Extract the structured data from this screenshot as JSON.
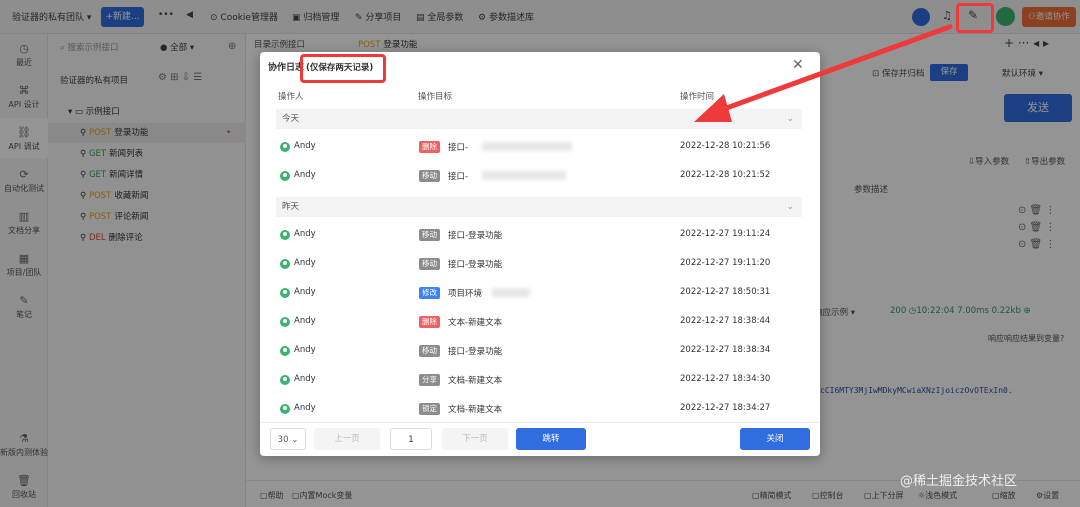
{
  "topbar": {
    "team": "验证器的私有团队",
    "new_btn": "+新建...",
    "more": "•••",
    "tabs": [
      "Cookie管理器",
      "归档管理",
      "分享项目",
      "全局参数",
      "参数描述库"
    ],
    "invite": "邀请协作"
  },
  "sidebar": {
    "items": [
      "最近",
      "API 设计",
      "API 调试",
      "自动化测试",
      "文档分享",
      "项目/团队",
      "笔记",
      "新版内测体验",
      "回收站"
    ]
  },
  "tree": {
    "search_placeholder": "搜索示例接口",
    "filter": "全部",
    "project": "验证器的私有项目",
    "folder": "示例接口",
    "items": [
      {
        "method": "POST",
        "name": "登录功能"
      },
      {
        "method": "GET",
        "name": "新闻列表"
      },
      {
        "method": "GET",
        "name": "新闻详情"
      },
      {
        "method": "POST",
        "name": "收藏新闻"
      },
      {
        "method": "POST",
        "name": "评论新闻"
      },
      {
        "method": "DEL",
        "name": "删除评论"
      }
    ]
  },
  "main": {
    "tab_folder": "目录示例接口",
    "tab_active_method": "POST",
    "tab_active_name": "登录功能",
    "save_btn": "保存",
    "save_and_clear": "保存并归档",
    "env": "默认环境",
    "send": "发送",
    "import": "导入参数",
    "export": "导出参数",
    "param_desc": "参数描述",
    "resp_example": "响应示例",
    "status": "200",
    "time": "10:22:04",
    "duration": "7.00ms",
    "size": "0.22kb",
    "resp_hint": "响应响应结果到变量?",
    "token_text": "cCI6MTY3MjIwMDkyMCwiaXNzIjoiczOvOTExIn0.",
    "bottom": [
      "帮助",
      "内置Mock变量",
      "精简模式",
      "控制台",
      "上下分屏",
      "浅色模式",
      "缩放",
      "设置"
    ]
  },
  "modal": {
    "title": "协作日志",
    "subtitle": "(仅保存两天记录)",
    "col_user": "操作人",
    "col_target": "操作目标",
    "col_time": "操作时间",
    "groups": [
      {
        "label": "今天",
        "rows": [
          {
            "user": "Andy",
            "tag": "删除",
            "tag_type": "del",
            "target": "接口-",
            "time": "2022-12-28 10:21:56"
          },
          {
            "user": "Andy",
            "tag": "移动",
            "tag_type": "mv",
            "target": "接口-",
            "time": "2022-12-28 10:21:52"
          }
        ]
      },
      {
        "label": "昨天",
        "rows": [
          {
            "user": "Andy",
            "tag": "移动",
            "tag_type": "mv",
            "target": "接口-登录功能",
            "time": "2022-12-27 19:11:24"
          },
          {
            "user": "Andy",
            "tag": "移动",
            "tag_type": "mv",
            "target": "接口-登录功能",
            "time": "2022-12-27 19:11:20"
          },
          {
            "user": "Andy",
            "tag": "修改",
            "tag_type": "edit",
            "target": "项目环境",
            "time": "2022-12-27 18:50:31"
          },
          {
            "user": "Andy",
            "tag": "删除",
            "tag_type": "del",
            "target": "文本-新建文本",
            "time": "2022-12-27 18:38:44"
          },
          {
            "user": "Andy",
            "tag": "移动",
            "tag_type": "mv",
            "target": "接口-登录功能",
            "time": "2022-12-27 18:38:34"
          },
          {
            "user": "Andy",
            "tag": "分享",
            "tag_type": "mv",
            "target": "文档-新建文本",
            "time": "2022-12-27 18:34:30"
          },
          {
            "user": "Andy",
            "tag": "锁定",
            "tag_type": "mv",
            "target": "文档-新建文本",
            "time": "2022-12-27 18:34:27"
          }
        ]
      }
    ],
    "page_size": "30",
    "prev": "上一页",
    "page": "1",
    "next": "下一页",
    "jump": "跳转",
    "close": "关闭"
  },
  "watermark": "@稀土掘金技术社区",
  "colors": {
    "accent": "#2f6de0",
    "highlight": "#ee3a3a",
    "invite": "#f26d3a"
  }
}
